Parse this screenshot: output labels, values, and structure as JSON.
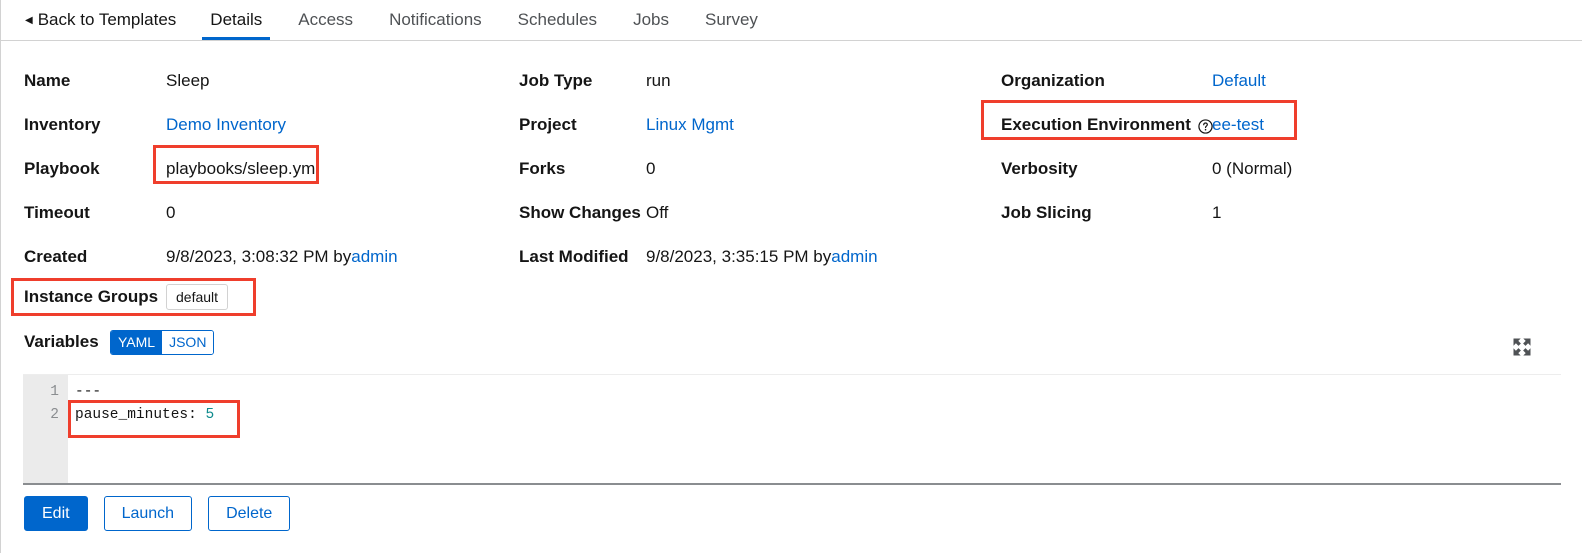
{
  "tabs": {
    "back_label": "Back to Templates",
    "items": [
      {
        "label": "Details",
        "active": true
      },
      {
        "label": "Access",
        "active": false
      },
      {
        "label": "Notifications",
        "active": false
      },
      {
        "label": "Schedules",
        "active": false
      },
      {
        "label": "Jobs",
        "active": false
      },
      {
        "label": "Survey",
        "active": false
      }
    ]
  },
  "details": {
    "column1": [
      {
        "label": "Name",
        "value": "Sleep",
        "type": "text"
      },
      {
        "label": "Inventory",
        "value": "Demo Inventory",
        "type": "link"
      },
      {
        "label": "Playbook",
        "value": "playbooks/sleep.yml",
        "type": "text"
      },
      {
        "label": "Timeout",
        "value": "0",
        "type": "text"
      },
      {
        "label": "Created",
        "value": "9/8/2023, 3:08:32 PM by ",
        "suffix_link": "admin",
        "type": "text-link"
      }
    ],
    "column2": [
      {
        "label": "Job Type",
        "value": "run",
        "type": "text"
      },
      {
        "label": "Project",
        "value": "Linux Mgmt",
        "type": "link"
      },
      {
        "label": "Forks",
        "value": "0",
        "type": "text"
      },
      {
        "label": "Show Changes",
        "value": "Off",
        "type": "text"
      },
      {
        "label": "Last Modified",
        "value": "9/8/2023, 3:35:15 PM by ",
        "suffix_link": "admin",
        "type": "text-link"
      }
    ],
    "column3": [
      {
        "label": "Organization",
        "value": "Default",
        "type": "link"
      },
      {
        "label": "Execution Environment",
        "value": "ee-test",
        "type": "link",
        "has_help": true
      },
      {
        "label": "Verbosity",
        "value": "0 (Normal)",
        "type": "text"
      },
      {
        "label": "Job Slicing",
        "value": "1",
        "type": "text"
      }
    ]
  },
  "instance_groups": {
    "label": "Instance Groups",
    "chips": [
      "default"
    ]
  },
  "variables": {
    "label": "Variables",
    "format_options": [
      {
        "label": "YAML",
        "active": true
      },
      {
        "label": "JSON",
        "active": false
      }
    ],
    "expand_icon": "expand-arrows-icon",
    "code_lines": [
      {
        "number": "1",
        "text": "---",
        "value": ""
      },
      {
        "number": "2",
        "text": "pause_minutes: ",
        "value": "5"
      }
    ]
  },
  "actions": [
    {
      "label": "Edit",
      "style": "primary"
    },
    {
      "label": "Launch",
      "style": "secondary"
    },
    {
      "label": "Delete",
      "style": "secondary"
    }
  ],
  "colors": {
    "accent": "#0066cc",
    "annotation": "#ef3e2c",
    "text": "#151515",
    "muted": "#8a8d90",
    "gutter": "#ebebeb",
    "code_value": "#0f8b8d"
  }
}
